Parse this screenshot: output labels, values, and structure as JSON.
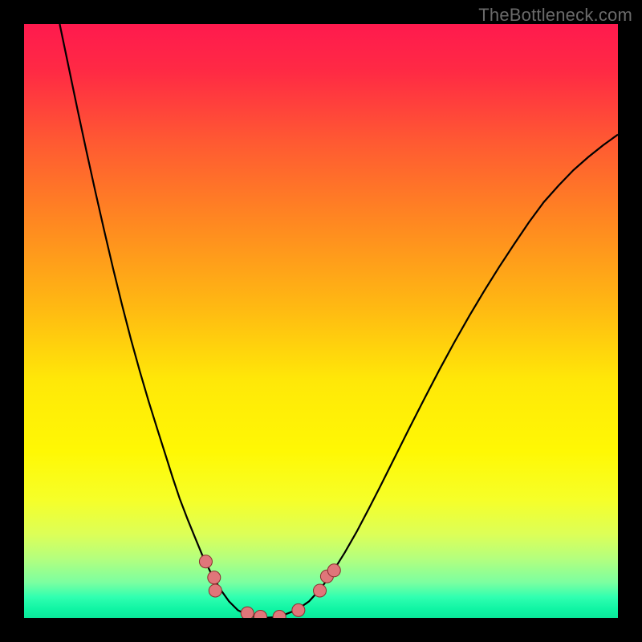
{
  "watermark": {
    "text": "TheBottleneck.com"
  },
  "chart_data": {
    "type": "line",
    "title": "",
    "xlabel": "",
    "ylabel": "",
    "xlim": [
      0,
      1
    ],
    "ylim": [
      0,
      1
    ],
    "background_gradient": {
      "stops": [
        {
          "offset": 0.0,
          "color": "#ff1a4e"
        },
        {
          "offset": 0.08,
          "color": "#ff2a44"
        },
        {
          "offset": 0.2,
          "color": "#ff5a32"
        },
        {
          "offset": 0.34,
          "color": "#ff8a20"
        },
        {
          "offset": 0.48,
          "color": "#ffba12"
        },
        {
          "offset": 0.6,
          "color": "#ffe808"
        },
        {
          "offset": 0.72,
          "color": "#fff804"
        },
        {
          "offset": 0.8,
          "color": "#f6ff28"
        },
        {
          "offset": 0.86,
          "color": "#dcff58"
        },
        {
          "offset": 0.9,
          "color": "#b4ff7e"
        },
        {
          "offset": 0.94,
          "color": "#7cffa0"
        },
        {
          "offset": 0.965,
          "color": "#30ffb0"
        },
        {
          "offset": 0.985,
          "color": "#10f5a4"
        },
        {
          "offset": 1.0,
          "color": "#0ae89a"
        }
      ]
    },
    "series": [
      {
        "name": "curve",
        "color": "#000000",
        "width": 2.2,
        "x": [
          0.06,
          0.075,
          0.09,
          0.105,
          0.12,
          0.135,
          0.15,
          0.165,
          0.18,
          0.195,
          0.21,
          0.225,
          0.238,
          0.25,
          0.262,
          0.275,
          0.288,
          0.3,
          0.315,
          0.33,
          0.345,
          0.36,
          0.38,
          0.4,
          0.42,
          0.44,
          0.46,
          0.48,
          0.5,
          0.52,
          0.54,
          0.56,
          0.58,
          0.6,
          0.625,
          0.65,
          0.675,
          0.7,
          0.725,
          0.75,
          0.775,
          0.8,
          0.825,
          0.85,
          0.875,
          0.9,
          0.925,
          0.95,
          0.975,
          1.0
        ],
        "y": [
          1.0,
          0.928,
          0.856,
          0.786,
          0.718,
          0.652,
          0.588,
          0.527,
          0.469,
          0.415,
          0.364,
          0.316,
          0.275,
          0.237,
          0.201,
          0.167,
          0.135,
          0.106,
          0.075,
          0.049,
          0.028,
          0.013,
          0.003,
          0.0,
          0.001,
          0.006,
          0.014,
          0.028,
          0.05,
          0.078,
          0.11,
          0.145,
          0.183,
          0.222,
          0.272,
          0.322,
          0.371,
          0.419,
          0.465,
          0.509,
          0.551,
          0.591,
          0.629,
          0.666,
          0.7,
          0.728,
          0.754,
          0.776,
          0.796,
          0.814
        ]
      }
    ],
    "markers": {
      "color": "#e0767a",
      "stroke": "#8a2f2f",
      "radius": 8,
      "points": [
        {
          "x": 0.306,
          "y": 0.095
        },
        {
          "x": 0.32,
          "y": 0.068
        },
        {
          "x": 0.322,
          "y": 0.046
        },
        {
          "x": 0.376,
          "y": 0.008
        },
        {
          "x": 0.398,
          "y": 0.002
        },
        {
          "x": 0.43,
          "y": 0.002
        },
        {
          "x": 0.462,
          "y": 0.013
        },
        {
          "x": 0.498,
          "y": 0.046
        },
        {
          "x": 0.51,
          "y": 0.07
        },
        {
          "x": 0.522,
          "y": 0.08
        }
      ]
    }
  }
}
